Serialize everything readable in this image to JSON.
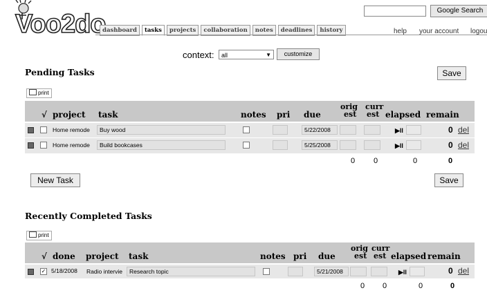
{
  "app": {
    "logo_text": "Voo2do"
  },
  "nav": {
    "tabs": [
      "dashboard",
      "tasks",
      "projects",
      "collaboration",
      "notes",
      "deadlines",
      "history"
    ],
    "active": "tasks"
  },
  "search": {
    "button_label": "Google Search",
    "value": ""
  },
  "toplinks": {
    "help": "help",
    "account": "your account",
    "logout": "logou"
  },
  "context": {
    "label": "context:",
    "selected": "all",
    "customize_label": "customize"
  },
  "pending": {
    "title": "Pending Tasks",
    "save_label": "Save",
    "print_label": "print",
    "columns": {
      "check": "√",
      "project": "project",
      "task": "task",
      "notes": "notes",
      "pri": "pri",
      "due": "due",
      "orig_est_1": "orig",
      "orig_est_2": "est",
      "curr_est_1": "curr",
      "curr_est_2": "est",
      "elapsed": "elapsed",
      "remain": "remain"
    },
    "rows": [
      {
        "project": "Home remode",
        "task": "Buy wood",
        "due": "5/22/2008",
        "remain": "0",
        "del": "del",
        "play": "▶II"
      },
      {
        "project": "Home remode",
        "task": "Build bookcases",
        "due": "5/25/2008",
        "remain": "0",
        "del": "del",
        "play": "▶II"
      }
    ],
    "totals": {
      "orig": "0",
      "curr": "0",
      "elapsed": "0",
      "remain": "0"
    },
    "new_task_label": "New Task"
  },
  "completed": {
    "title": "Recently Completed Tasks",
    "print_label": "print",
    "columns": {
      "check": "√",
      "done": "done",
      "project": "project",
      "task": "task",
      "notes": "notes",
      "pri": "pri",
      "due": "due",
      "orig_est_1": "orig",
      "orig_est_2": "est",
      "curr_est_1": "curr",
      "curr_est_2": "est",
      "elapsed": "elapsed",
      "remain": "remain"
    },
    "rows": [
      {
        "done": "5/18/2008",
        "project": "Radio intervie",
        "task": "Research topic",
        "due": "5/21/2008",
        "remain": "0",
        "del": "del",
        "play": "▶II",
        "checked": "✓"
      }
    ],
    "totals": {
      "orig": "0",
      "curr": "0",
      "elapsed": "0",
      "remain": "0"
    }
  }
}
